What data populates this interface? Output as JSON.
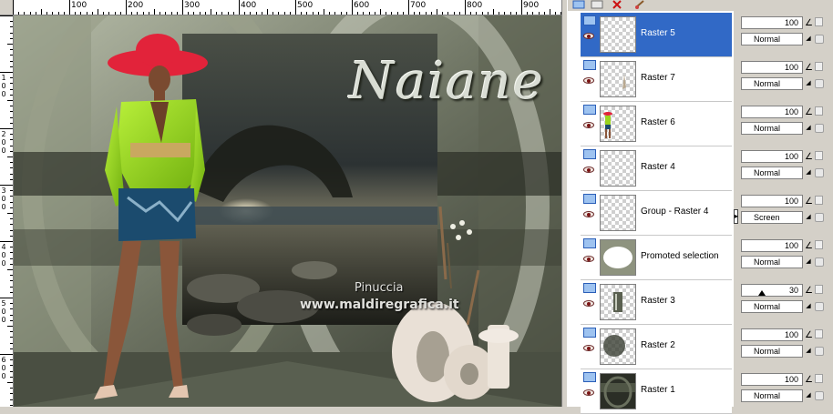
{
  "ruler": {
    "top_labels": [
      "100",
      "200",
      "300",
      "400",
      "500",
      "600",
      "700",
      "800",
      "900"
    ],
    "left_labels": [
      "1\n0\n0",
      "2\n0\n0",
      "3\n0\n0",
      "4\n0\n0",
      "5\n0\n0",
      "6\n0\n0",
      "7\n0\n0"
    ]
  },
  "artwork": {
    "title": "Naiane",
    "credit_line1": "Pinuccia",
    "credit_line2": "www.maldiregrafica.it"
  },
  "palette_toolbar": {
    "icons": [
      "layer-icon",
      "delete-icon",
      "brush-icon"
    ]
  },
  "layers": [
    {
      "name": "Raster 5",
      "opacity": "100",
      "blend": "Normal",
      "selected": true,
      "thumb": "empty"
    },
    {
      "name": "Raster 7",
      "opacity": "100",
      "blend": "Normal",
      "selected": false,
      "thumb": "figure-small"
    },
    {
      "name": "Raster 6",
      "opacity": "100",
      "blend": "Normal",
      "selected": false,
      "thumb": "woman"
    },
    {
      "name": "Raster 4",
      "opacity": "100",
      "blend": "Normal",
      "selected": false,
      "thumb": "empty"
    },
    {
      "name": "Group - Raster 4",
      "opacity": "100",
      "blend": "Screen",
      "selected": false,
      "thumb": "empty"
    },
    {
      "name": "Promoted selection",
      "opacity": "100",
      "blend": "Normal",
      "selected": false,
      "thumb": "circle"
    },
    {
      "name": "Raster 3",
      "opacity": "30",
      "blend": "Normal",
      "selected": false,
      "thumb": "stripes"
    },
    {
      "name": "Raster 2",
      "opacity": "100",
      "blend": "Normal",
      "selected": false,
      "thumb": "blur"
    },
    {
      "name": "Raster 1",
      "opacity": "100",
      "blend": "Normal",
      "selected": false,
      "thumb": "dark"
    }
  ],
  "colors": {
    "selection": "#3169c6",
    "panel": "#d4d0c8"
  }
}
